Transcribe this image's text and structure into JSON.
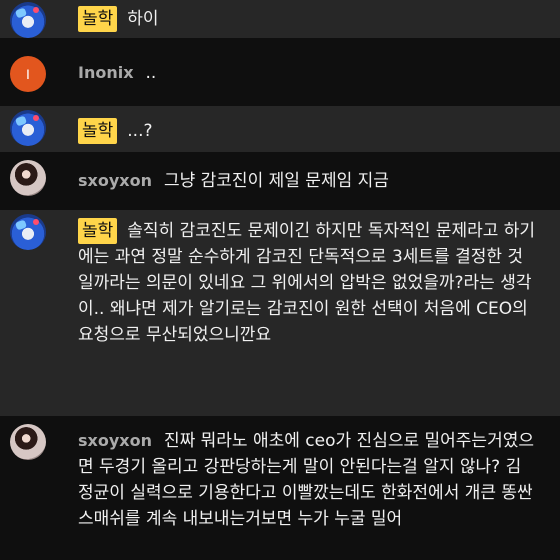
{
  "messages": [
    {
      "author": "놀학",
      "author_style": "badge",
      "avatar": "blue-avatar",
      "text": "하이"
    },
    {
      "author": "Inonix",
      "author_style": "name",
      "avatar": "orange-letter-avatar",
      "avatar_letter": "I",
      "text": ".."
    },
    {
      "author": "놀학",
      "author_style": "badge",
      "avatar": "blue-avatar",
      "text": "...?"
    },
    {
      "author": "sxoyxon",
      "author_style": "name",
      "avatar": "photo-avatar",
      "text": "그냥 감코진이 제일 문제임 지금"
    },
    {
      "author": "놀학",
      "author_style": "badge",
      "avatar": "blue-avatar",
      "text": "솔직히 감코진도 문제이긴 하지만 독자적인 문제라고 하기에는 과연 정말 순수하게 감코진 단독적으로 3세트를 결정한 것일까라는 의문이 있네요 그 위에서의 압박은 없었을까?라는 생각이.. 왜냐면 제가 알기로는 감코진이 원한 선택이 처음에 CEO의 요청으로 무산되었으니깐요"
    },
    {
      "author": "sxoyxon",
      "author_style": "name",
      "avatar": "photo-avatar",
      "text": "진짜 뭐라노 애초에 ceo가 진심으로 밀어주는거였으면 두경기 올리고 강판당하는게 말이 안된다는걸 알지 않나? 김정균이 실력으로 기용한다고 이빨깠는데도 한화전에서 개큰 똥싼 스매쉬를 계속 내보내는거보면 누가 누굴 밀어"
    }
  ],
  "colors": {
    "background": "#0f0f0f",
    "alt_row": "#272727",
    "badge": "#ffd54a",
    "author_name": "#aaaaaa",
    "message_text": "#f1f1f1",
    "orange_avatar": "#e2561e"
  }
}
